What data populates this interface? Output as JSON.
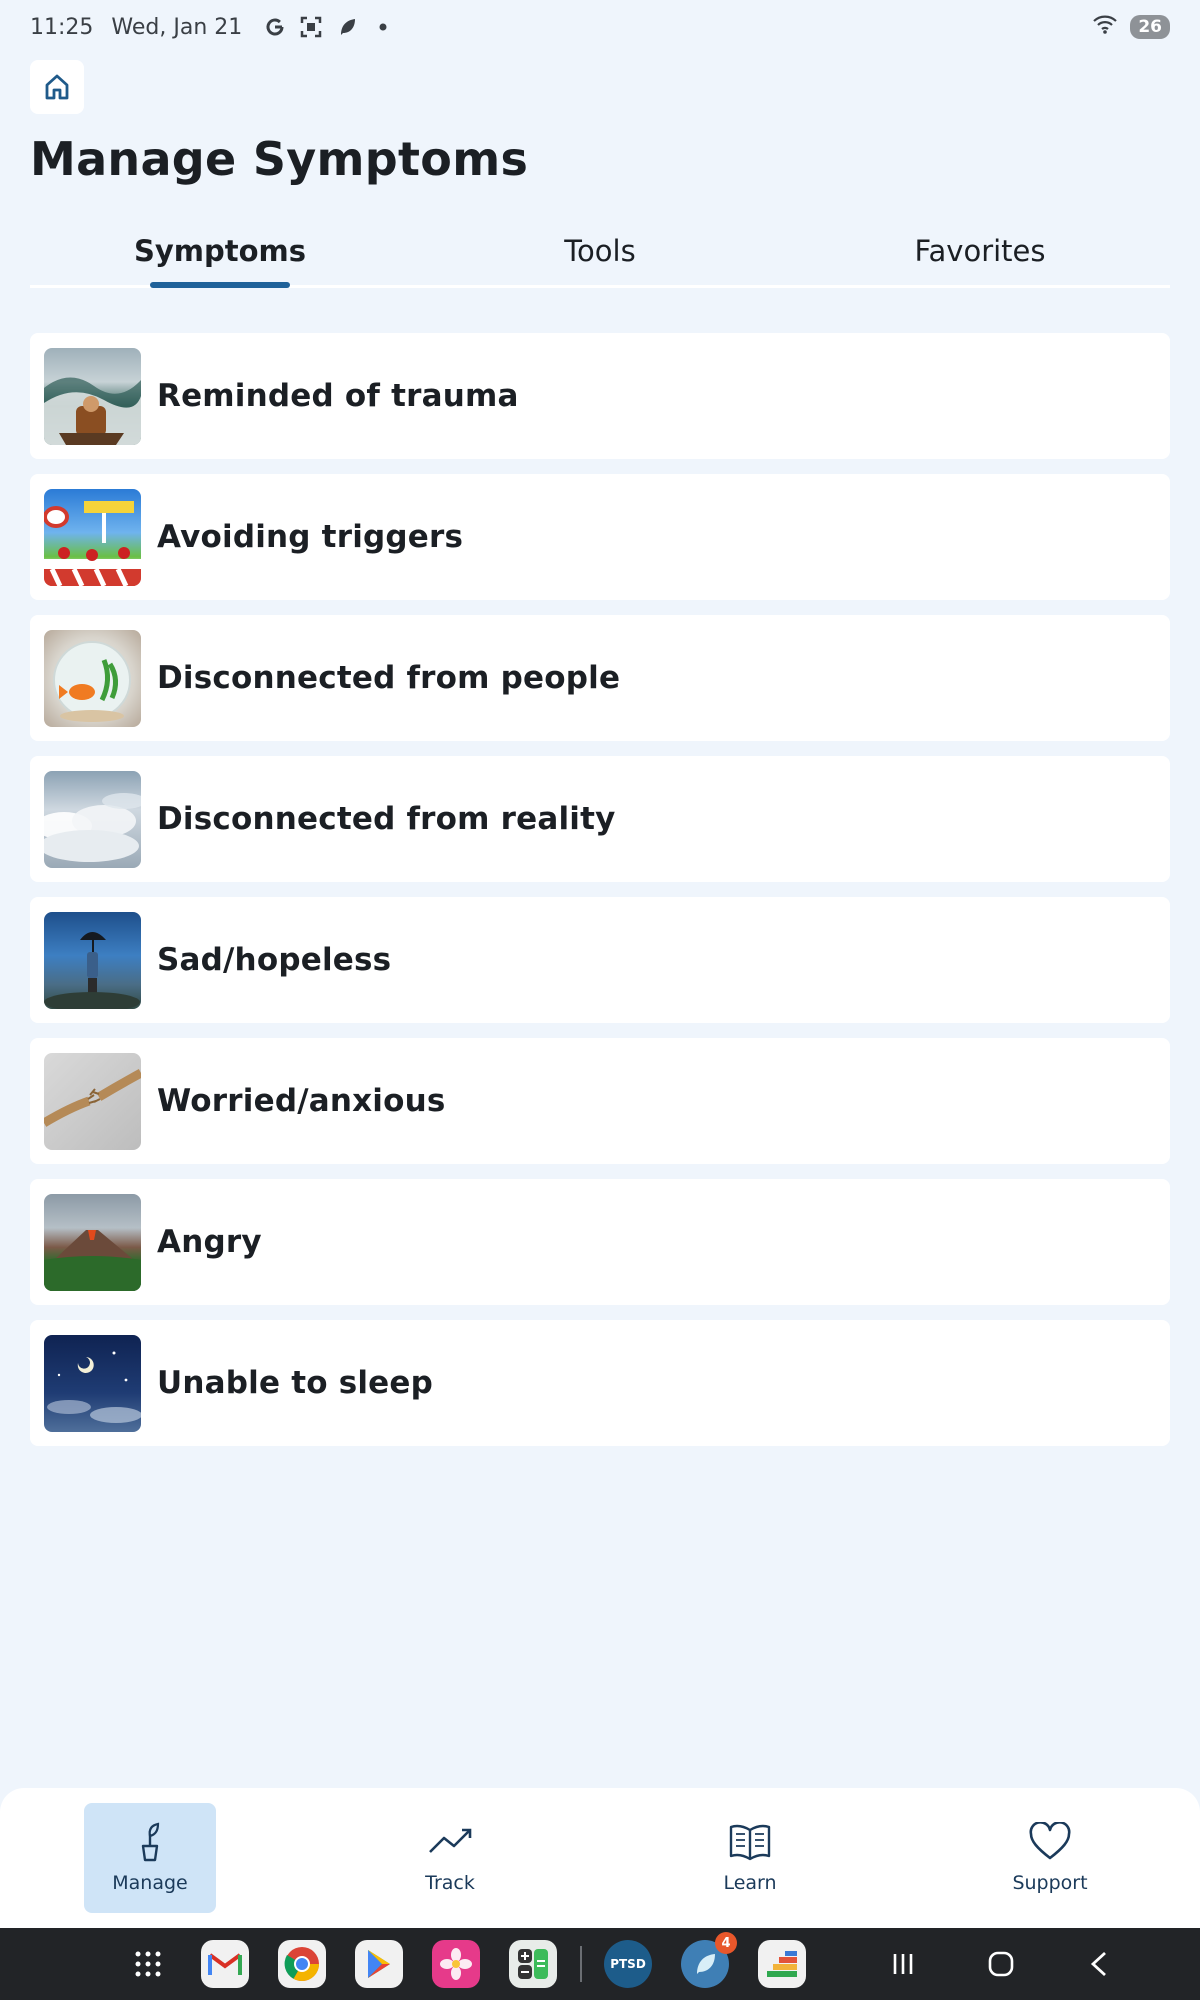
{
  "status_bar": {
    "time": "11:25",
    "date": "Wed, Jan 21",
    "battery": "26",
    "icons": [
      "google-icon",
      "screenshot-icon",
      "leaf-icon",
      "dot-icon",
      "wifi-icon",
      "battery-icon"
    ]
  },
  "header": {
    "home_icon": "home-icon",
    "title": "Manage Symptoms"
  },
  "tabs": [
    {
      "label": "Symptoms",
      "active": true
    },
    {
      "label": "Tools",
      "active": false
    },
    {
      "label": "Favorites",
      "active": false
    }
  ],
  "symptoms": [
    {
      "label": "Reminded of trauma",
      "image": "ocean-wave-boat-image"
    },
    {
      "label": "Avoiding triggers",
      "image": "road-barrier-sign-image"
    },
    {
      "label": "Disconnected from people",
      "image": "goldfish-bowl-image"
    },
    {
      "label": "Disconnected from reality",
      "image": "clouds-image"
    },
    {
      "label": "Sad/hopeless",
      "image": "person-umbrella-image"
    },
    {
      "label": "Worried/anxious",
      "image": "fraying-rope-image"
    },
    {
      "label": "Angry",
      "image": "volcano-image"
    },
    {
      "label": "Unable to sleep",
      "image": "night-sky-moon-image"
    }
  ],
  "bottom_nav": [
    {
      "label": "Manage",
      "icon": "plant-icon",
      "active": true
    },
    {
      "label": "Track",
      "icon": "trend-line-icon",
      "active": false
    },
    {
      "label": "Learn",
      "icon": "book-icon",
      "active": false
    },
    {
      "label": "Support",
      "icon": "heart-icon",
      "active": false
    }
  ],
  "taskbar": {
    "apps": [
      "app-drawer",
      "gmail",
      "chrome",
      "play-store",
      "gallery",
      "calculator",
      "ptsd-coach",
      "leaf-app",
      "stairs-app"
    ],
    "ptsd_label": "PTSD",
    "leaf_badge": "4"
  },
  "colors": {
    "background": "#eff5fc",
    "accent": "#1f6199",
    "active_nav": "#cfe4f7"
  }
}
